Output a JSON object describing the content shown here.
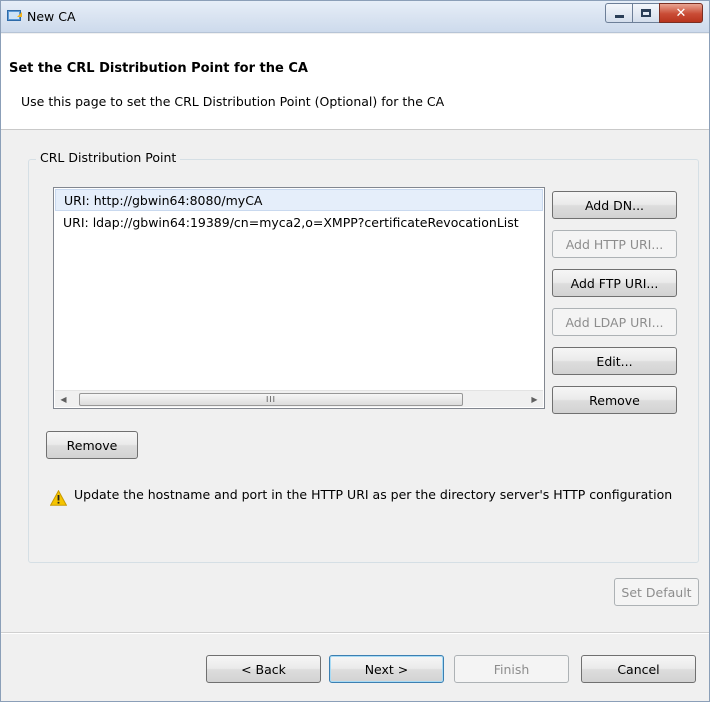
{
  "window": {
    "title": "New CA",
    "controls": {
      "minimize": "minimize",
      "maximize": "maximize",
      "close": "close"
    }
  },
  "header": {
    "title": "Set the CRL Distribution Point for the CA",
    "description": "Use this page to set the CRL Distribution Point (Optional) for the CA"
  },
  "group": {
    "label": "CRL Distribution Point",
    "uris": [
      "URI: http://gbwin64:8080/myCA",
      "URI: ldap://gbwin64:19389/cn=myca2,o=XMPP?certificateRevocationList"
    ],
    "side_buttons": {
      "add_dn": "Add DN...",
      "add_http_uri": "Add HTTP URI...",
      "add_ftp_uri": "Add FTP URI...",
      "add_ldap_uri": "Add LDAP URI...",
      "edit": "Edit...",
      "remove": "Remove"
    },
    "scroll_thumb_grip": "III",
    "remove_button": "Remove",
    "warning": "Update the hostname and port in the HTTP URI as per the directory server's HTTP configuration"
  },
  "set_default": "Set Default",
  "footer": {
    "back": "< Back",
    "next": "Next >",
    "finish": "Finish",
    "cancel": "Cancel"
  },
  "colors": {
    "selection": "#e5eefa",
    "warning": "#f5c400",
    "close_button": "#c94c35"
  },
  "icons": {
    "app": "ca-wizard-icon",
    "warning": "warning-triangle-icon"
  }
}
